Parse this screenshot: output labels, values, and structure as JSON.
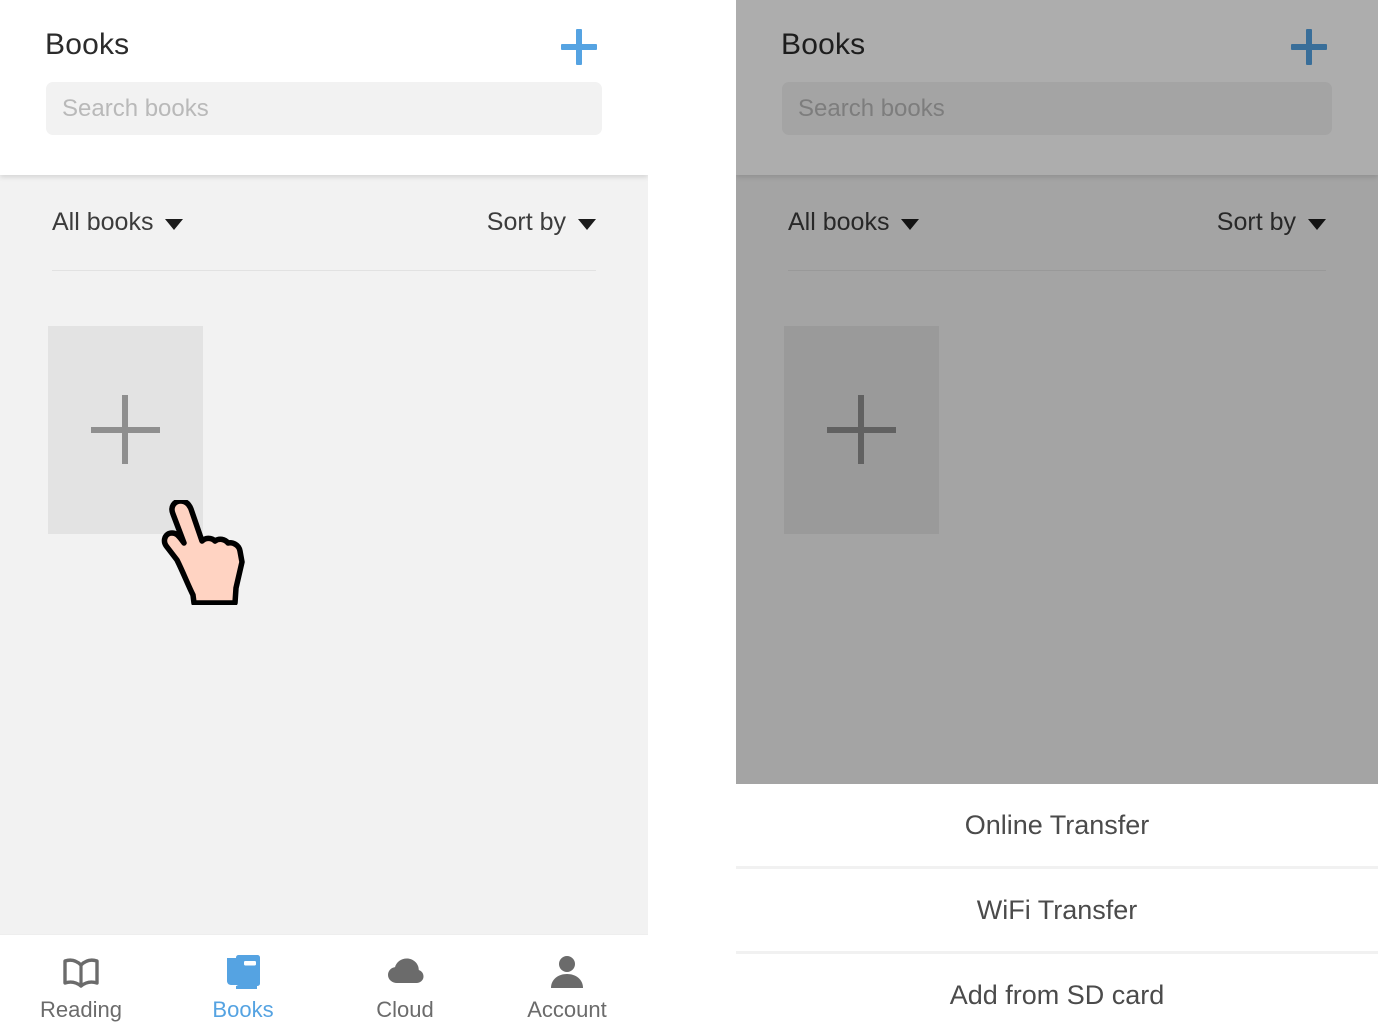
{
  "app": {
    "title": "Books",
    "add_icon": "plus-icon",
    "accent_color": "#55a3e2"
  },
  "search": {
    "placeholder": "Search books",
    "value": ""
  },
  "filters": {
    "scope_label": "All books",
    "scope_caret_icon": "chevron-down-icon",
    "sort_label": "Sort by",
    "sort_caret_icon": "chevron-down-icon"
  },
  "shelf": {
    "add_book_tile_icon": "plus-icon",
    "books": []
  },
  "cursor": {
    "icon": "pointing-hand-cursor",
    "fill_color": "#ffd3c2",
    "outline_color": "#000000"
  },
  "tabbar": {
    "items": [
      {
        "label": "Reading",
        "icon": "open-book-icon",
        "active": false
      },
      {
        "label": "Books",
        "icon": "stacked-books-icon",
        "active": true
      },
      {
        "label": "Cloud",
        "icon": "cloud-icon",
        "active": false
      },
      {
        "label": "Account",
        "icon": "person-icon",
        "active": false
      }
    ],
    "active_color": "#55a3e2",
    "inactive_color": "#6b6b6b"
  },
  "action_sheet": {
    "items": [
      {
        "label": "Online Transfer"
      },
      {
        "label": "WiFi Transfer"
      },
      {
        "label": "Add from SD card"
      }
    ],
    "overlay_color": "rgba(0,0,0,0.32)"
  }
}
